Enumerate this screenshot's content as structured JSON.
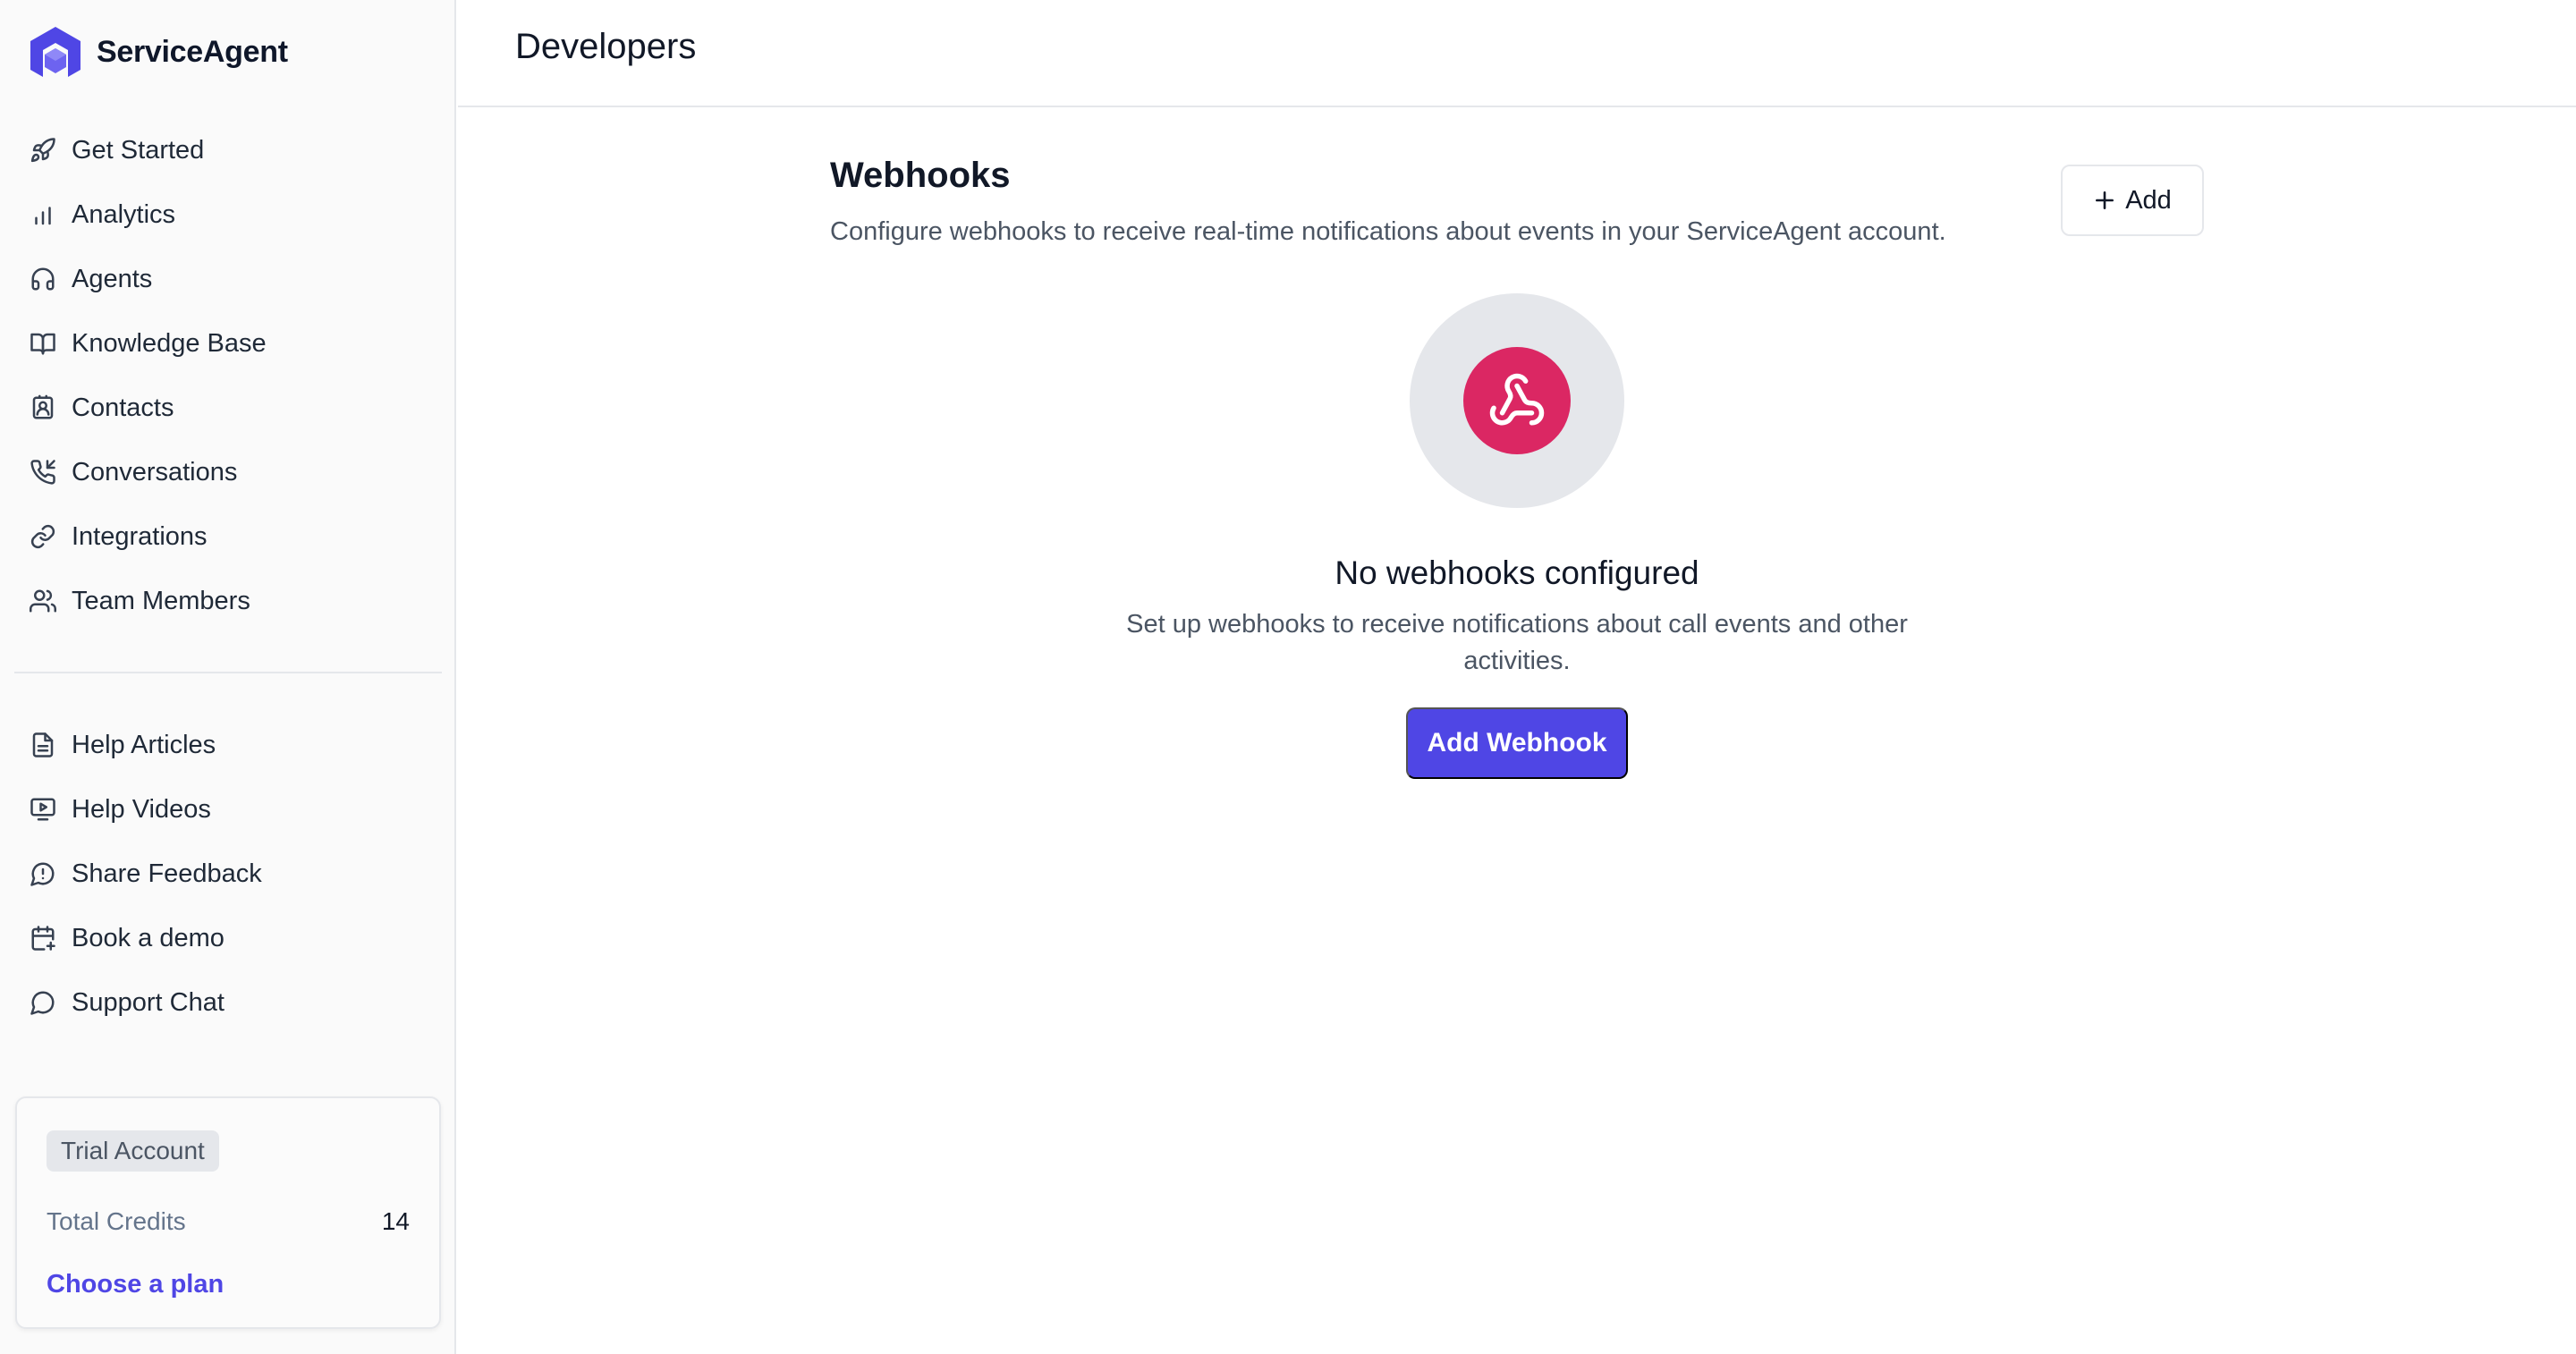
{
  "brand": {
    "name": "ServiceAgent",
    "color": "#4f46e5"
  },
  "sidebar": {
    "primary_items": [
      {
        "label": "Get Started",
        "icon": "rocket-icon"
      },
      {
        "label": "Analytics",
        "icon": "bar-chart-icon"
      },
      {
        "label": "Agents",
        "icon": "headset-icon"
      },
      {
        "label": "Knowledge Base",
        "icon": "book-open-icon"
      },
      {
        "label": "Contacts",
        "icon": "contact-icon"
      },
      {
        "label": "Conversations",
        "icon": "phone-incoming-icon"
      },
      {
        "label": "Integrations",
        "icon": "link-icon"
      },
      {
        "label": "Team Members",
        "icon": "users-icon"
      }
    ],
    "secondary_items": [
      {
        "label": "Help Articles",
        "icon": "file-text-icon"
      },
      {
        "label": "Help Videos",
        "icon": "video-icon"
      },
      {
        "label": "Share Feedback",
        "icon": "feedback-icon"
      },
      {
        "label": "Book a demo",
        "icon": "calendar-plus-icon"
      },
      {
        "label": "Support Chat",
        "icon": "chat-icon"
      }
    ],
    "plan": {
      "badge": "Trial Account",
      "credits_label": "Total Credits",
      "credits_value": "14",
      "cta": "Choose a plan"
    }
  },
  "header": {
    "title": "Developers"
  },
  "webhooks": {
    "title": "Webhooks",
    "description": "Configure webhooks to receive real-time notifications about events in your ServiceAgent account.",
    "add_label": "Add",
    "empty_icon": "webhook-icon",
    "empty_icon_color": "#db2763",
    "empty_title": "No webhooks configured",
    "empty_description": "Set up webhooks to receive notifications about call events and other activities.",
    "primary_button": "Add Webhook"
  }
}
